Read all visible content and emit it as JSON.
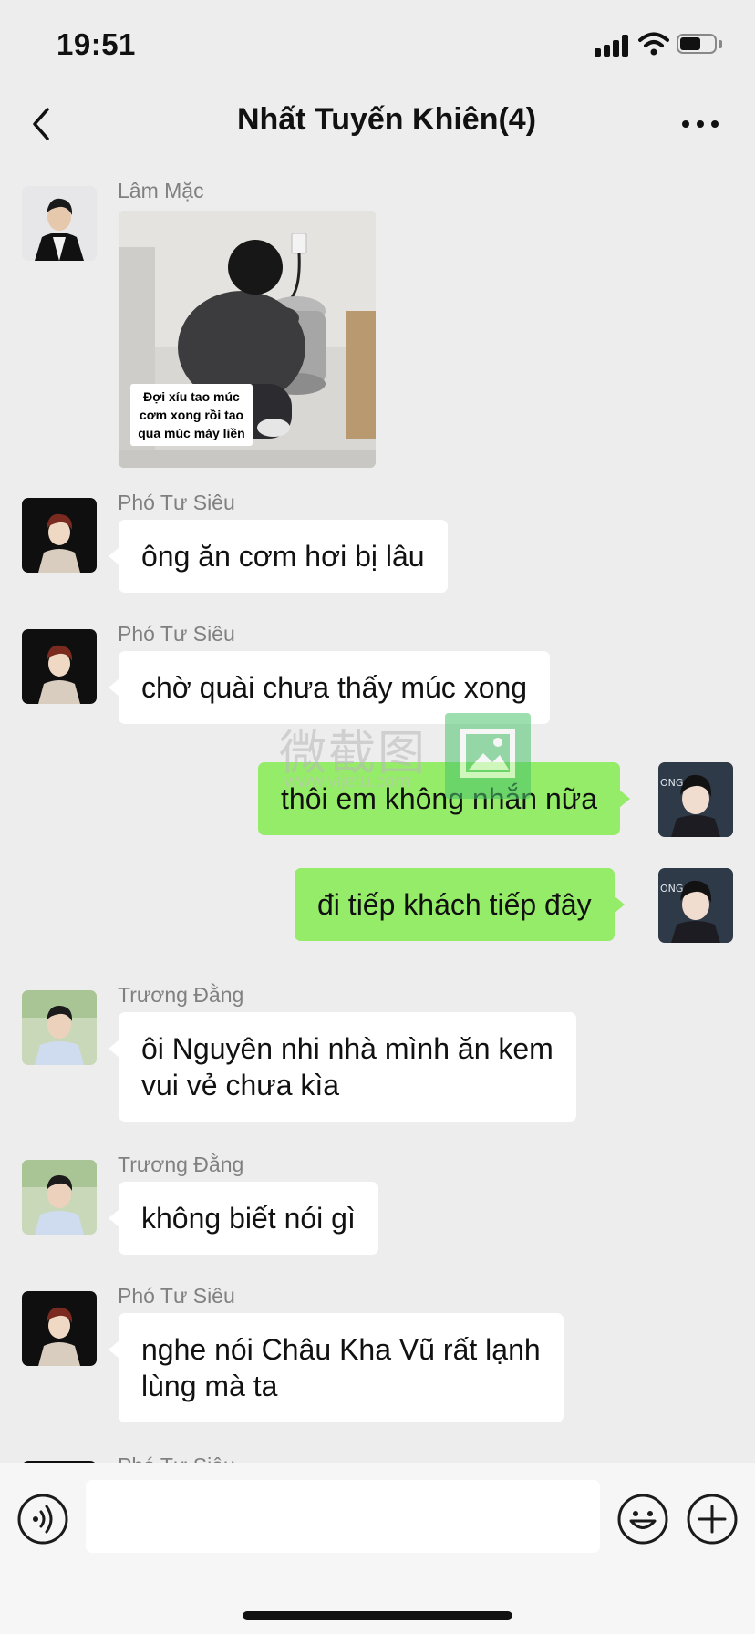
{
  "status_bar": {
    "time": "19:51"
  },
  "header": {
    "title": "Nhất Tuyến Khiên(4)"
  },
  "messages": [
    {
      "side": "left",
      "sender": "Lâm Mặc",
      "type": "image",
      "avatar": "avatar-lam-mac",
      "caption": "Đợi xíu tao múc cơm xong rồi tao qua múc mày liền"
    },
    {
      "side": "left",
      "sender": "Phó Tư Siêu",
      "type": "text",
      "avatar": "avatar-pho-tu-sieu",
      "text": "ông ăn cơm hơi bị lâu"
    },
    {
      "side": "left",
      "sender": "Phó Tư Siêu",
      "type": "text",
      "avatar": "avatar-pho-tu-sieu",
      "text": "chờ quài chưa thấy múc xong"
    },
    {
      "side": "right",
      "type": "text",
      "avatar": "avatar-self",
      "text": "thôi em không nhắn nữa"
    },
    {
      "side": "right",
      "type": "text",
      "avatar": "avatar-self",
      "text": "đi tiếp khách tiếp đây"
    },
    {
      "side": "left",
      "sender": "Trương Đằng",
      "type": "text",
      "avatar": "avatar-truong-dang",
      "text": "ôi Nguyên nhi nhà mình ăn kem\nvui vẻ chưa kìa"
    },
    {
      "side": "left",
      "sender": "Trương Đằng",
      "type": "text",
      "avatar": "avatar-truong-dang",
      "text": "không biết nói gì"
    },
    {
      "side": "left",
      "sender": "Phó Tư Siêu",
      "type": "text",
      "avatar": "avatar-pho-tu-sieu",
      "text": "nghe nói Châu Kha Vũ rất lạnh\nlùng mà ta"
    },
    {
      "side": "left",
      "sender": "Phó Tư Siêu",
      "type": "partial",
      "avatar": "avatar-pho-tu-sieu"
    }
  ],
  "watermark": {
    "text": "微截图",
    "url": "www.vijetu.com"
  },
  "colors": {
    "background": "#ededed",
    "incoming_bubble": "#ffffff",
    "outgoing_bubble": "#95ec69",
    "sender_name": "#808080"
  },
  "icons": {
    "back": "chevron-left-icon",
    "more": "more-dots-icon",
    "voice": "voice-icon",
    "emoji": "emoji-icon",
    "plus": "plus-icon"
  }
}
